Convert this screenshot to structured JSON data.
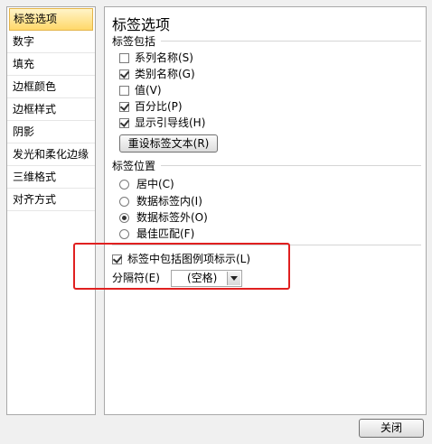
{
  "nav": {
    "items": [
      "标签选项",
      "数字",
      "填充",
      "边框颜色",
      "边框样式",
      "阴影",
      "发光和柔化边缘",
      "三维格式",
      "对齐方式"
    ]
  },
  "main": {
    "title": "标签选项",
    "contains_section": "标签包括",
    "checkboxes": [
      {
        "label": "系列名称(S)",
        "checked": false
      },
      {
        "label": "类别名称(G)",
        "checked": true
      },
      {
        "label": "值(V)",
        "checked": false
      },
      {
        "label": "百分比(P)",
        "checked": true
      },
      {
        "label": "显示引导线(H)",
        "checked": true
      }
    ],
    "reset_button": "重设标签文本(R)",
    "position_section": "标签位置",
    "radios": [
      {
        "label": "居中(C)",
        "checked": false
      },
      {
        "label": "数据标签内(I)",
        "checked": false
      },
      {
        "label": "数据标签外(O)",
        "checked": true
      },
      {
        "label": "最佳匹配(F)",
        "checked": false
      }
    ],
    "legend_key": {
      "label": "标签中包括图例项标示(L)",
      "checked": true
    },
    "separator_label": "分隔符(E)",
    "separator_value": "(空格)"
  },
  "footer": {
    "close_button": "关闭"
  },
  "colors": {
    "highlight": "#e02020",
    "selected_nav": "#ffd86a"
  }
}
